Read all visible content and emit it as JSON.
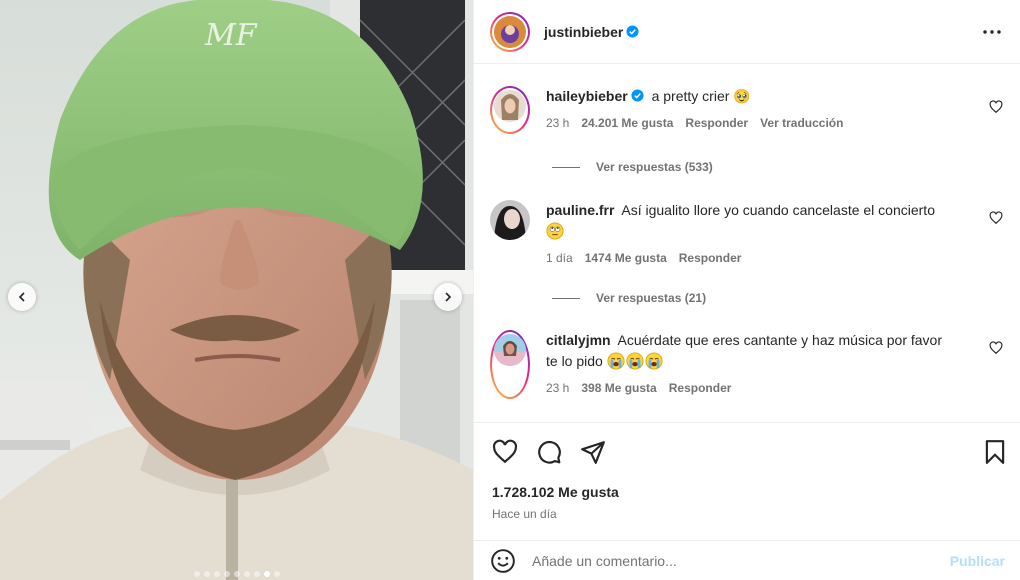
{
  "post": {
    "author": "justinbieber",
    "author_verified": true
  },
  "comments": [
    {
      "username": "haileybieber",
      "verified": true,
      "text": "a pretty crier 🥹",
      "time": "23 h",
      "likes": "24.201 Me gusta",
      "reply_label": "Responder",
      "translate_label": "Ver traducción",
      "view_replies": "Ver respuestas (533)"
    },
    {
      "username": "pauline.frr",
      "verified": false,
      "text": "Así igualito llore yo cuando cancelaste el concierto",
      "emoji": [
        "rolling-eyes-emoji"
      ],
      "time": "1 día",
      "likes": "1474 Me gusta",
      "reply_label": "Responder",
      "view_replies": "Ver respuestas (21)"
    },
    {
      "username": "citlalyjmn",
      "verified": false,
      "text": "Acuérdate que eres cantante y haz música por favor te lo pido",
      "emoji": [
        "crying-emoji",
        "crying-emoji",
        "crying-emoji"
      ],
      "time": "23 h",
      "likes": "398 Me gusta",
      "reply_label": "Responder"
    }
  ],
  "stats": {
    "likes": "1.728.102 Me gusta",
    "time_ago": "Hace un día"
  },
  "add_comment": {
    "placeholder": "Añade un comentario...",
    "publish_label": "Publicar"
  },
  "carousel": {
    "slide_count": 9,
    "active_index": 7
  },
  "colors": {
    "verified": "#0095f6",
    "publish_disabled": "#b2dffc",
    "secondary_text": "#737373",
    "hat_green": "#8fc47a"
  },
  "icons": [
    "chevron-left-icon",
    "chevron-right-icon",
    "more-icon",
    "heart-icon",
    "comment-icon",
    "share-icon",
    "bookmark-icon",
    "emoji-icon",
    "verified-icon"
  ]
}
